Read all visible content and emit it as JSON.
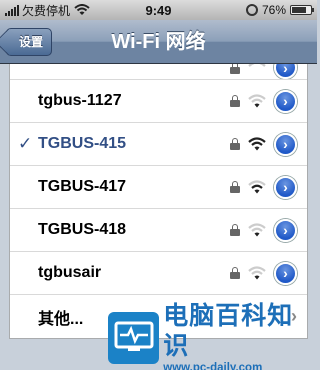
{
  "status_bar": {
    "carrier": "欠费停机",
    "time": "9:49",
    "battery": "76%",
    "battery_level": 0.76
  },
  "nav": {
    "back_label": "设置",
    "title": "Wi-Fi 网络"
  },
  "networks": [
    {
      "name": "tgbus-1127",
      "selected": false,
      "locked": true,
      "signal": 1
    },
    {
      "name": "TGBUS-415",
      "selected": true,
      "locked": true,
      "signal": 3
    },
    {
      "name": "TGBUS-417",
      "selected": false,
      "locked": true,
      "signal": 2
    },
    {
      "name": "TGBUS-418",
      "selected": false,
      "locked": true,
      "signal": 1
    },
    {
      "name": "tgbusair",
      "selected": false,
      "locked": true,
      "signal": 1
    }
  ],
  "other_label": "其他...",
  "checkmark": "✓",
  "watermark": {
    "main": "电脑百科知识",
    "url": "www.pc-daily.com"
  },
  "colors": {
    "accent": "#324f85",
    "detail_button": "#2059c8",
    "nav_bar": "#6d84a2"
  }
}
